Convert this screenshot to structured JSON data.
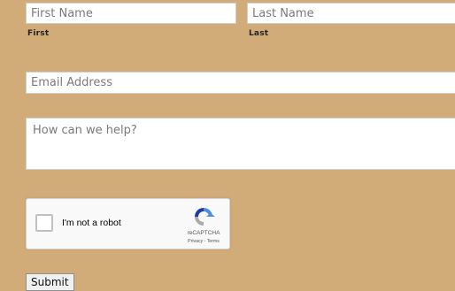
{
  "form": {
    "first_name": {
      "value": "",
      "placeholder": "First Name",
      "sublabel": "First"
    },
    "last_name": {
      "value": "",
      "placeholder": "Last Name",
      "sublabel": "Last"
    },
    "email": {
      "value": "",
      "placeholder": "Email Address"
    },
    "message": {
      "value": "",
      "placeholder": "How can we help?"
    },
    "submit_label": "Submit"
  },
  "recaptcha": {
    "label": "I'm not a robot",
    "brand": "reCAPTCHA",
    "privacy": "Privacy",
    "separator": " - ",
    "terms": "Terms",
    "checked": false
  },
  "colors": {
    "background": "#d2ac78",
    "field_bg": "#ffffff"
  }
}
